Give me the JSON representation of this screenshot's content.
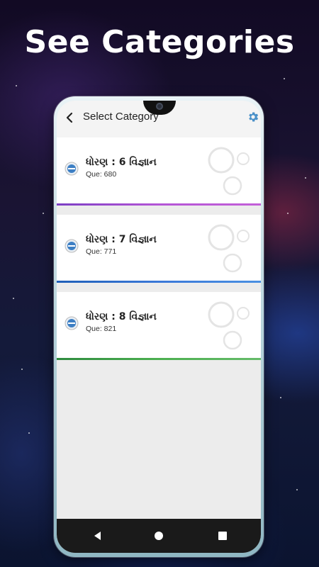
{
  "headline": "See Categories",
  "app_bar": {
    "title": "Select Category",
    "back_icon": "chevron-left-icon",
    "settings_icon": "gear-icon"
  },
  "categories": [
    {
      "title": "ધોરણ : 6 વિજ્ઞાન",
      "questions": "Que: 680",
      "accent": "#b455d6"
    },
    {
      "title": "ધોરણ : 7 વિજ્ઞાન",
      "questions": "Que: 771",
      "accent": "#3a78d8"
    },
    {
      "title": "ધોરણ : 8  વિજ્ઞાન",
      "questions": "Que: 821",
      "accent": "#4caf50"
    }
  ],
  "nav_bar": {
    "back": "triangle-back-icon",
    "home": "circle-home-icon",
    "recents": "square-recents-icon"
  },
  "colors": {
    "settings_icon": "#4a90c8",
    "app_background": "#ececec"
  }
}
